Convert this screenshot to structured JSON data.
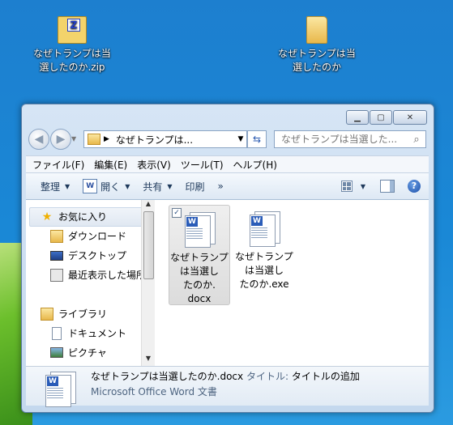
{
  "desktop": {
    "icons": [
      {
        "line1": "なぜトランプは当",
        "line2": "選したのか.zip"
      },
      {
        "line1": "なぜトランプは当",
        "line2": "選したのか"
      }
    ]
  },
  "window": {
    "address": "なぜトランプは...",
    "search_placeholder": "なぜトランプは当選した...",
    "menu": [
      "ファイル(F)",
      "編集(E)",
      "表示(V)",
      "ツール(T)",
      "ヘルプ(H)"
    ],
    "toolbar": {
      "organize": "整理",
      "open": "開く",
      "share": "共有",
      "print": "印刷",
      "more": "»"
    },
    "nav": [
      {
        "label": "お気に入り",
        "icon": "star-icon"
      },
      {
        "label": "ダウンロード",
        "icon": "downloads-icon"
      },
      {
        "label": "デスクトップ",
        "icon": "desktop-icon"
      },
      {
        "label": "最近表示した場所",
        "icon": "recent-places-icon"
      },
      {
        "label": "ライブラリ",
        "icon": "libraries-icon"
      },
      {
        "label": "ドキュメント",
        "icon": "documents-icon"
      },
      {
        "label": "ピクチャ",
        "icon": "pictures-icon"
      }
    ],
    "files": [
      {
        "l1": "なぜトランプ",
        "l2": "は当選し",
        "l3": "たのか.",
        "l4": "docx"
      },
      {
        "l1": "なぜトランプ",
        "l2": "は当選し",
        "l3": "たのか.exe"
      }
    ],
    "details": {
      "filename": "なぜトランプは当選したのか.docx",
      "title_label": "タイトル:",
      "title_value": "タイトルの追加",
      "type": "Microsoft Office Word 文書"
    }
  }
}
